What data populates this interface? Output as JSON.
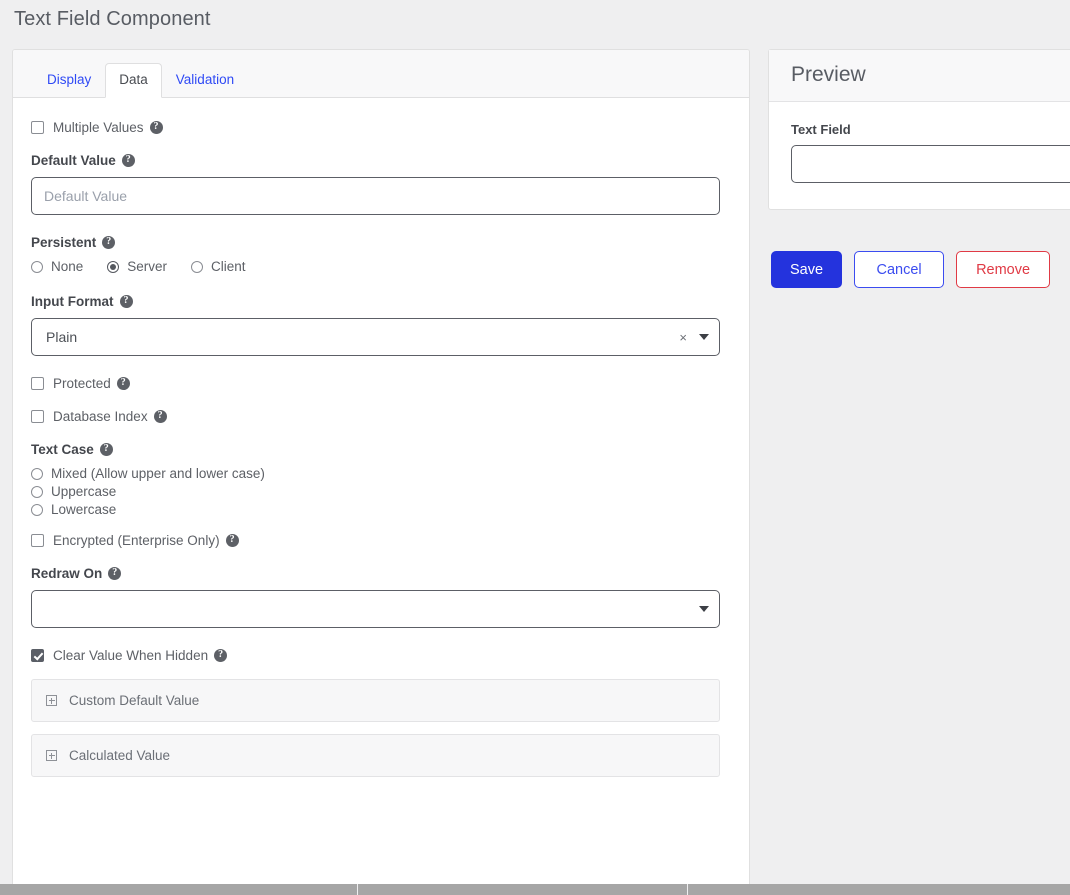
{
  "page": {
    "title": "Text Field Component"
  },
  "tabs": [
    {
      "label": "Display",
      "active": false
    },
    {
      "label": "Data",
      "active": true
    },
    {
      "label": "Validation",
      "active": false
    }
  ],
  "form": {
    "multiple_values": {
      "label": "Multiple Values",
      "checked": false,
      "help": "help-icon"
    },
    "default_value": {
      "label": "Default Value",
      "placeholder": "Default Value",
      "value": ""
    },
    "persistent": {
      "label": "Persistent",
      "options": [
        "None",
        "Server",
        "Client"
      ],
      "selected": "Server"
    },
    "input_format": {
      "label": "Input Format",
      "selected": "Plain",
      "clear_icon": "close-icon",
      "caret_icon": "chevron-down-icon"
    },
    "protected": {
      "label": "Protected",
      "checked": false
    },
    "database_index": {
      "label": "Database Index",
      "checked": false
    },
    "text_case": {
      "label": "Text Case",
      "options": [
        "Mixed (Allow upper and lower case)",
        "Uppercase",
        "Lowercase"
      ],
      "selected": ""
    },
    "encrypted": {
      "label": "Encrypted (Enterprise Only)",
      "checked": false
    },
    "redraw_on": {
      "label": "Redraw On",
      "selected": "",
      "caret_icon": "chevron-down-icon"
    },
    "clear_value_when_hidden": {
      "label": "Clear Value When Hidden",
      "checked": true
    },
    "collapsibles": [
      {
        "label": "Custom Default Value",
        "icon": "plus-square-icon",
        "expanded": false
      },
      {
        "label": "Calculated Value",
        "icon": "plus-square-icon",
        "expanded": false
      }
    ]
  },
  "preview": {
    "title": "Preview",
    "field_label": "Text Field",
    "field_value": ""
  },
  "actions": {
    "save": "Save",
    "cancel": "Cancel",
    "remove": "Remove"
  },
  "colors": {
    "accent_blue": "#2433dd",
    "link_blue": "#2f4af5",
    "danger_red": "#e03a45",
    "page_bg": "#efeff0",
    "panel_bg": "#ffffff"
  }
}
